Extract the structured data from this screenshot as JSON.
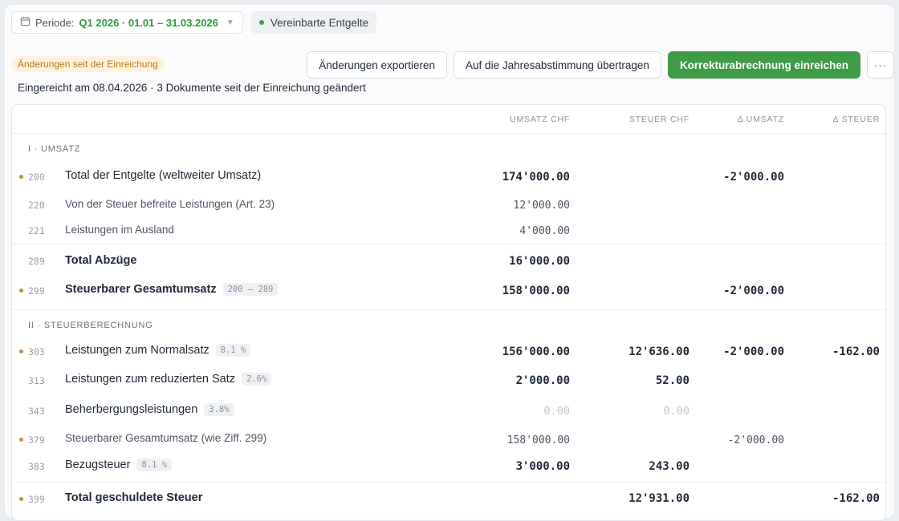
{
  "topbar": {
    "period_label": "Periode:",
    "period_value": "Q1 2026 · 01.01 – 31.03.2026",
    "status": "Vereinbarte Entgelte"
  },
  "changes_badge": "Änderungen seit der Einreichung",
  "submitted_text": "Eingereicht am 08.04.2026 · 3 Dokumente seit der Einreichung geändert",
  "actions": {
    "export": "Änderungen exportieren",
    "transfer": "Auf die Jahresabstimmung übertragen",
    "submit": "Korrekturabrechnung einreichen",
    "more": "···"
  },
  "columns": {
    "umsatz": "UMSATZ CHF",
    "steuer": "STEUER CHF",
    "d_umsatz": "Δ UMSATZ",
    "d_steuer": "Δ STEUER"
  },
  "sections": {
    "s1": "I · UMSATZ",
    "s2": "II · STEUERBERECHNUNG"
  },
  "rows": {
    "r200": {
      "code": "200",
      "label": "Total der Entgelte (weltweiter Umsatz)",
      "umsatz": "174'000.00",
      "d_umsatz": "-2'000.00"
    },
    "r220": {
      "code": "220",
      "label": "Von der Steuer befreite Leistungen (Art. 23)",
      "umsatz": "12'000.00"
    },
    "r221": {
      "code": "221",
      "label": "Leistungen im Ausland",
      "umsatz": "4'000.00"
    },
    "r289": {
      "code": "289",
      "label": "Total Abzüge",
      "umsatz": "16'000.00"
    },
    "r299": {
      "code": "299",
      "label": "Steuerbarer Gesamtumsatz",
      "chip": "200 – 289",
      "umsatz": "158'000.00",
      "d_umsatz": "-2'000.00"
    },
    "r303": {
      "code": "303",
      "label": "Leistungen zum Normalsatz",
      "chip": "8.1 %",
      "umsatz": "156'000.00",
      "steuer": "12'636.00",
      "d_umsatz": "-2'000.00",
      "d_steuer": "-162.00"
    },
    "r313": {
      "code": "313",
      "label": "Leistungen zum reduzierten Satz",
      "chip": "2.6%",
      "umsatz": "2'000.00",
      "steuer": "52.00"
    },
    "r343": {
      "code": "343",
      "label": "Beherbergungsleistungen",
      "chip": "3.8%",
      "umsatz": "0.00",
      "steuer": "0.00"
    },
    "r379": {
      "code": "379",
      "label": "Steuerbarer Gesamtumsatz (wie Ziff. 299)",
      "umsatz": "158'000.00",
      "d_umsatz": "-2'000.00"
    },
    "r383": {
      "code": "383",
      "label": "Bezugsteuer",
      "chip": "8.1 %",
      "umsatz": "3'000.00",
      "steuer": "243.00"
    },
    "r399": {
      "code": "399",
      "label": "Total geschuldete Steuer",
      "steuer": "12'931.00",
      "d_steuer": "-162.00"
    }
  },
  "colors": {
    "accent_green": "#3f9b46",
    "change_marker": "#c58a3a",
    "badge_bg": "#fdf2dc"
  }
}
